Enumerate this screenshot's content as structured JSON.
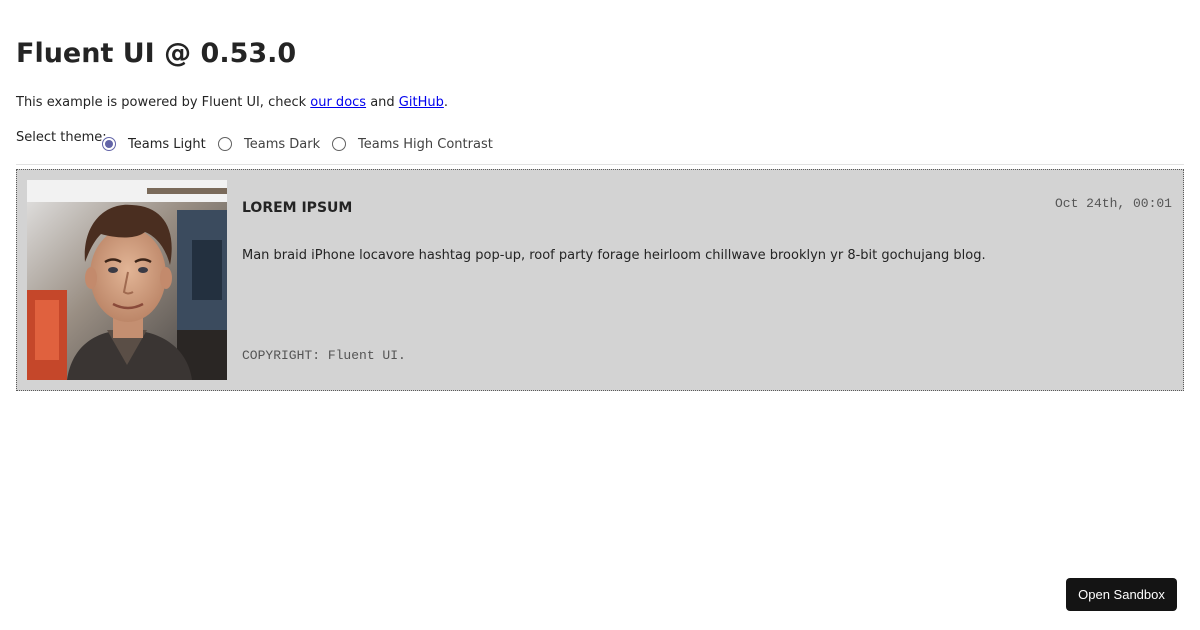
{
  "header": {
    "title": "Fluent UI @ 0.53.0"
  },
  "intro": {
    "prefix": "This example is powered by Fluent UI, check ",
    "docs_link": "our docs",
    "middle": " and ",
    "github_link": "GitHub",
    "suffix": "."
  },
  "theme": {
    "label": "Select theme:",
    "options": [
      {
        "label": "Teams Light",
        "checked": true
      },
      {
        "label": "Teams Dark",
        "checked": false
      },
      {
        "label": "Teams High Contrast",
        "checked": false
      }
    ]
  },
  "card": {
    "title": "LOREM IPSUM",
    "date": "Oct 24th, 00:01",
    "body": "Man braid iPhone locavore hashtag pop-up, roof party forage heirloom chillwave brooklyn yr 8-bit gochujang blog.",
    "footer": "COPYRIGHT: Fluent UI.",
    "image_icon": "portrait-photo-icon"
  },
  "sandbox": {
    "label": "Open Sandbox"
  },
  "colors": {
    "accent": "#6264a7",
    "card_background": "#d3d3d3",
    "link": "#0000ee",
    "button_background": "#141414"
  }
}
